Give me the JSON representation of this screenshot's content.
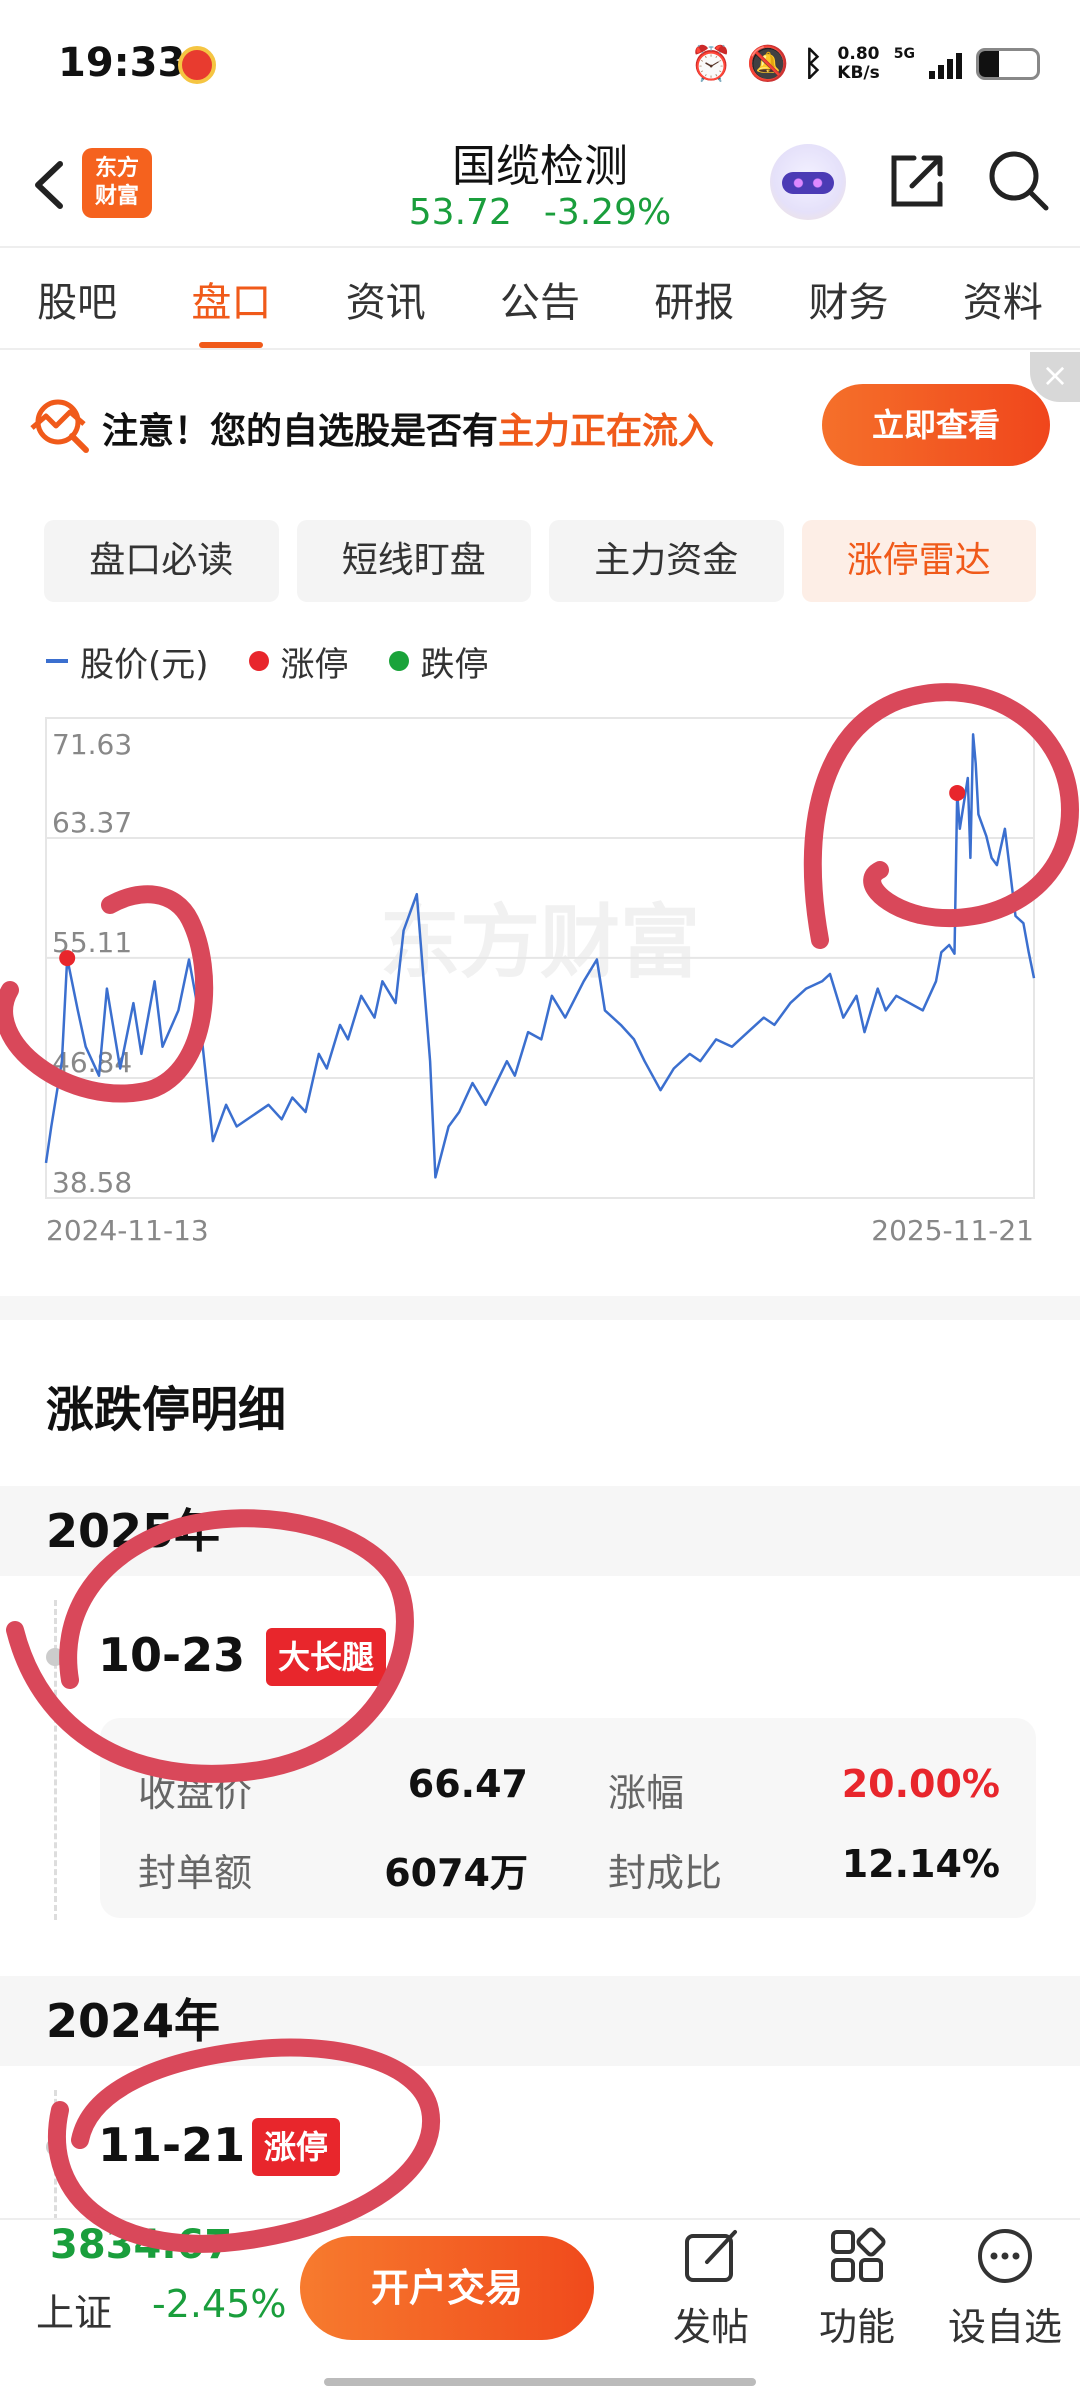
{
  "status_bar": {
    "time": "19:33",
    "net_speed_value": "0.80",
    "net_speed_unit": "KB/s",
    "network": "5G",
    "battery_percent": 35
  },
  "header": {
    "logo_line1": "东方",
    "logo_line2": "财富",
    "stock_name": "国缆检测",
    "price": "53.72",
    "change_pct": "-3.29%"
  },
  "tabs": [
    {
      "label": "股吧",
      "active": false
    },
    {
      "label": "盘口",
      "active": true
    },
    {
      "label": "资讯",
      "active": false
    },
    {
      "label": "公告",
      "active": false
    },
    {
      "label": "研报",
      "active": false
    },
    {
      "label": "财务",
      "active": false
    },
    {
      "label": "资料",
      "active": false
    }
  ],
  "notice": {
    "prefix": "注意！您的自选股是否有",
    "highlight": "主力正在流入",
    "button": "立即查看",
    "close": "×"
  },
  "sub_tabs": [
    {
      "label": "盘口必读",
      "active": false
    },
    {
      "label": "短线盯盘",
      "active": false
    },
    {
      "label": "主力资金",
      "active": false
    },
    {
      "label": "涨停雷达",
      "active": true
    }
  ],
  "legend": {
    "price": "股价(元)",
    "limit_up": "涨停",
    "limit_down": "跌停"
  },
  "colors": {
    "accent": "#f05a1a",
    "price_line": "#3b6fcf",
    "limit_up": "#e8262c",
    "limit_down": "#1aa33a",
    "down_green": "#1a9e3c",
    "annotation_red": "#d9485a"
  },
  "chart_data": {
    "type": "line",
    "series": [
      {
        "name": "股价(元)",
        "points": [
          [
            "2024-11-13",
            41.0
          ],
          [
            "2024-11-15",
            43.5
          ],
          [
            "2024-11-19",
            48.0
          ],
          [
            "2024-11-21",
            55.1
          ],
          [
            "2024-11-25",
            51.5
          ],
          [
            "2024-11-28",
            49.0
          ],
          [
            "2024-12-03",
            47.0
          ],
          [
            "2024-12-06",
            53.0
          ],
          [
            "2024-12-11",
            47.5
          ],
          [
            "2024-12-16",
            52.0
          ],
          [
            "2024-12-19",
            48.5
          ],
          [
            "2024-12-24",
            53.5
          ],
          [
            "2024-12-27",
            49.0
          ],
          [
            "2025-01-02",
            51.5
          ],
          [
            "2025-01-06",
            55.0
          ],
          [
            "2025-01-10",
            51.0
          ],
          [
            "2025-01-15",
            42.5
          ],
          [
            "2025-01-20",
            45.0
          ],
          [
            "2025-01-24",
            43.5
          ],
          [
            "2025-02-05",
            45.0
          ],
          [
            "2025-02-10",
            44.0
          ],
          [
            "2025-02-14",
            45.5
          ],
          [
            "2025-02-19",
            44.5
          ],
          [
            "2025-02-24",
            48.5
          ],
          [
            "2025-02-27",
            47.5
          ],
          [
            "2025-03-04",
            50.5
          ],
          [
            "2025-03-07",
            49.5
          ],
          [
            "2025-03-12",
            52.5
          ],
          [
            "2025-03-17",
            51.0
          ],
          [
            "2025-03-20",
            53.5
          ],
          [
            "2025-03-25",
            52.0
          ],
          [
            "2025-03-28",
            57.0
          ],
          [
            "2025-04-02",
            59.5
          ],
          [
            "2025-04-07",
            48.0
          ],
          [
            "2025-04-09",
            40.0
          ],
          [
            "2025-04-14",
            43.5
          ],
          [
            "2025-04-18",
            44.5
          ],
          [
            "2025-04-23",
            46.5
          ],
          [
            "2025-04-28",
            45.0
          ],
          [
            "2025-05-06",
            48.0
          ],
          [
            "2025-05-09",
            47.0
          ],
          [
            "2025-05-14",
            50.0
          ],
          [
            "2025-05-19",
            49.5
          ],
          [
            "2025-05-23",
            52.5
          ],
          [
            "2025-05-28",
            51.0
          ],
          [
            "2025-06-04",
            53.5
          ],
          [
            "2025-06-09",
            55.0
          ],
          [
            "2025-06-12",
            51.5
          ],
          [
            "2025-06-18",
            50.5
          ],
          [
            "2025-06-23",
            49.5
          ],
          [
            "2025-06-27",
            48.0
          ],
          [
            "2025-07-03",
            46.0
          ],
          [
            "2025-07-08",
            47.5
          ],
          [
            "2025-07-14",
            48.5
          ],
          [
            "2025-07-18",
            48.0
          ],
          [
            "2025-07-24",
            49.5
          ],
          [
            "2025-07-30",
            49.0
          ],
          [
            "2025-08-05",
            50.0
          ],
          [
            "2025-08-11",
            51.0
          ],
          [
            "2025-08-15",
            50.5
          ],
          [
            "2025-08-21",
            52.0
          ],
          [
            "2025-08-27",
            53.0
          ],
          [
            "2025-09-02",
            53.5
          ],
          [
            "2025-09-05",
            54.0
          ],
          [
            "2025-09-10",
            51.0
          ],
          [
            "2025-09-15",
            52.5
          ],
          [
            "2025-09-18",
            50.0
          ],
          [
            "2025-09-23",
            53.0
          ],
          [
            "2025-09-26",
            51.5
          ],
          [
            "2025-09-30",
            52.5
          ],
          [
            "2025-10-10",
            51.5
          ],
          [
            "2025-10-15",
            53.5
          ],
          [
            "2025-10-17",
            55.5
          ],
          [
            "2025-10-20",
            56.0
          ],
          [
            "2025-10-22",
            55.4
          ],
          [
            "2025-10-23",
            66.47
          ],
          [
            "2025-10-24",
            64.0
          ],
          [
            "2025-10-27",
            67.5
          ],
          [
            "2025-10-28",
            62.0
          ],
          [
            "2025-10-29",
            70.5
          ],
          [
            "2025-10-30",
            68.5
          ],
          [
            "2025-10-31",
            65.0
          ],
          [
            "2025-11-03",
            63.5
          ],
          [
            "2025-11-05",
            62.0
          ],
          [
            "2025-11-07",
            61.5
          ],
          [
            "2025-11-10",
            64.0
          ],
          [
            "2025-11-12",
            61.0
          ],
          [
            "2025-11-14",
            58.0
          ],
          [
            "2025-11-17",
            57.5
          ],
          [
            "2025-11-19",
            55.5
          ],
          [
            "2025-11-21",
            53.72
          ]
        ]
      }
    ],
    "limit_up_points": [
      [
        "2024-11-21",
        55.1
      ],
      [
        "2025-10-23",
        66.47
      ]
    ],
    "y_ticks": [
      "71.63",
      "63.37",
      "55.11",
      "46.84",
      "38.58"
    ],
    "x_labels": [
      "2024-11-13",
      "2025-11-21"
    ],
    "x_range": [
      "2024-11-13",
      "2025-11-21"
    ],
    "ylim": [
      38.58,
      71.63
    ],
    "grid": true,
    "watermark": "东方财富"
  },
  "detail": {
    "title": "涨跌停明细",
    "years": [
      {
        "year": "2025年",
        "events": [
          {
            "date": "10-23",
            "tag": "大长腿",
            "rows": [
              {
                "l1": "收盘价",
                "v1": "66.47",
                "l2": "涨幅",
                "v2": "20.00%"
              },
              {
                "l1": "封单额",
                "v1": "6074万",
                "l2": "封成比",
                "v2": "12.14%"
              }
            ]
          }
        ]
      },
      {
        "year": "2024年",
        "events": [
          {
            "date": "11-21",
            "tag": "涨停"
          }
        ]
      }
    ]
  },
  "bottom_bar": {
    "index_value": "3834.67",
    "index_name": "上证",
    "index_change": "-2.45%",
    "open_account": "开户交易",
    "post": "发帖",
    "functions": "功能",
    "add_watch": "设自选"
  }
}
